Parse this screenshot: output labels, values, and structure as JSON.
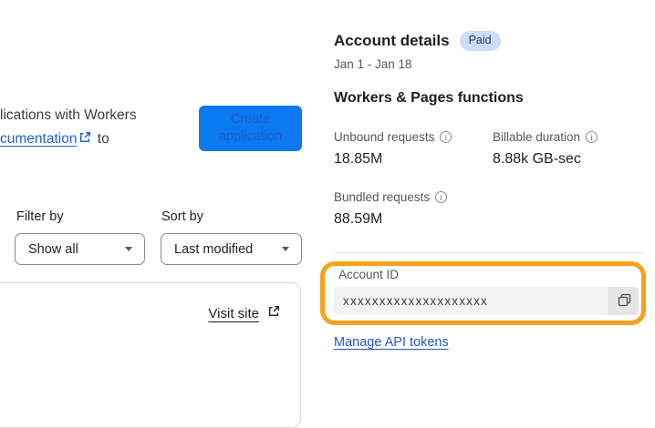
{
  "left": {
    "intro_line1": "lications with Workers",
    "intro_link_text": "cumentation",
    "intro_tail": "to",
    "create_button_label": "Create application",
    "filter_by_label": "Filter by",
    "filter_value": "Show all",
    "sort_by_label": "Sort by",
    "sort_value": "Last modified",
    "visit_site_label": "Visit site"
  },
  "account": {
    "title": "Account details",
    "badge": "Paid",
    "date_range": "Jan 1 - Jan 18",
    "section_title": "Workers & Pages functions",
    "metrics": [
      {
        "label": "Unbound requests",
        "value": "18.85M"
      },
      {
        "label": "Billable duration",
        "value": "8.88k GB-sec"
      },
      {
        "label": "Bundled requests",
        "value": "88.59M"
      }
    ],
    "account_id_label": "Account ID",
    "account_id_value": "xxxxxxxxxxxxxxxxxxxx",
    "manage_link_label": "Manage API tokens"
  },
  "icons": {
    "info_glyph": "i"
  },
  "colors": {
    "accent_blue": "#0c79f1",
    "link_blue": "#2356c7",
    "badge_bg": "#cdddf9",
    "badge_text": "#21375e",
    "highlight_orange": "#f7a21b"
  }
}
